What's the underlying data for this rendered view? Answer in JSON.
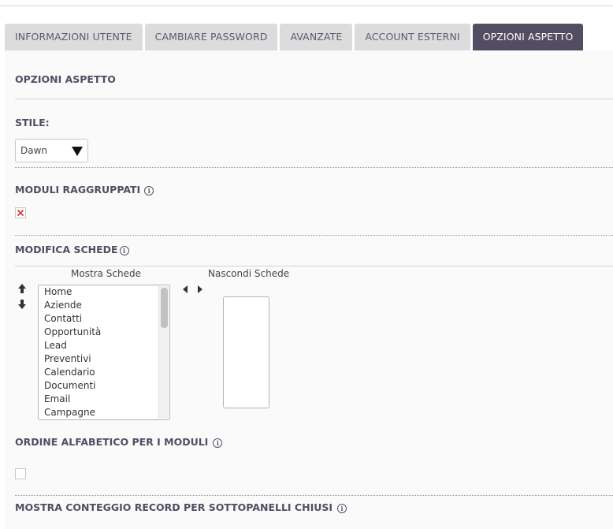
{
  "tabs": [
    {
      "label": "INFORMAZIONI UTENTE",
      "active": false
    },
    {
      "label": "CAMBIARE PASSWORD",
      "active": false
    },
    {
      "label": "AVANZATE",
      "active": false
    },
    {
      "label": "ACCOUNT ESTERNI",
      "active": false
    },
    {
      "label": "OPZIONI ASPETTO",
      "active": true
    }
  ],
  "section_title": "OPZIONI ASPETTO",
  "style": {
    "label": "STILE:",
    "value": "Dawn"
  },
  "grouped_modules": {
    "label": "MODULI RAGGRUPPATI",
    "checked": false,
    "info_icon": "info-icon"
  },
  "edit_tabs": {
    "label": "MODIFICA SCHEDE",
    "show_label": "Mostra Schede",
    "hide_label": "Nascondi Schede",
    "show_items": [
      "Home",
      "Aziende",
      "Contatti",
      "Opportunità",
      "Lead",
      "Preventivi",
      "Calendario",
      "Documenti",
      "Email",
      "Campagne"
    ],
    "hide_items": []
  },
  "alpha_order": {
    "label": "ORDINE ALFABETICO PER I MODULI",
    "checked": false
  },
  "subpanel_count": {
    "label": "MOSTRA CONTEGGIO RECORD PER SOTTOPANELLI CHIUSI"
  },
  "colors": {
    "accent": "#534d64",
    "tab_inactive": "#dcdcdc",
    "error_x": "#e8463a"
  }
}
